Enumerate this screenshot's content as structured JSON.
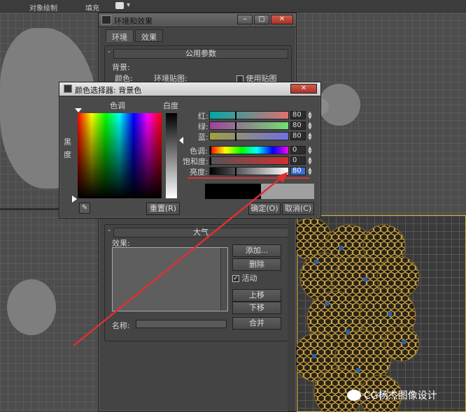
{
  "topbar": {
    "item1": "对象绘制",
    "item2": "填充"
  },
  "env_window": {
    "title": "环境和效果",
    "tabs": [
      "环境",
      "效果"
    ],
    "common_params_header": "公用参数",
    "background_label": "背景:",
    "color_label": "颜色:",
    "env_map_label": "环境贴图:",
    "use_map_label": "使用贴图",
    "atmosphere_header": "大气",
    "effects_label": "效果:",
    "add_label": "添加...",
    "delete_label": "删除",
    "active_label": "活动",
    "move_up_label": "上移",
    "move_down_label": "下移",
    "name_label": "名称:",
    "merge_label": "合并"
  },
  "color_picker": {
    "title": "颜色选择器: 背景色",
    "hue_label": "色调",
    "whiteness_label": "白度",
    "blackness_label": "黑度",
    "reset_label": "重置(R)",
    "ok_label": "确定(O)",
    "cancel_label": "取消(C)",
    "channels": [
      {
        "label": "红:",
        "value": "80"
      },
      {
        "label": "绿:",
        "value": "80"
      },
      {
        "label": "蓝:",
        "value": "80"
      },
      {
        "label": "色调:",
        "value": "0"
      },
      {
        "label": "饱和度:",
        "value": "0"
      },
      {
        "label": "亮度:",
        "value": "80"
      }
    ],
    "old_color": "#000000",
    "new_color": "#505050"
  },
  "watermark": {
    "text": "CG杨杰图像设计"
  },
  "colors": {
    "accent_red": "#e03030",
    "honeycomb": "#c8a24a",
    "cell_blue": "#2f5fa8"
  }
}
